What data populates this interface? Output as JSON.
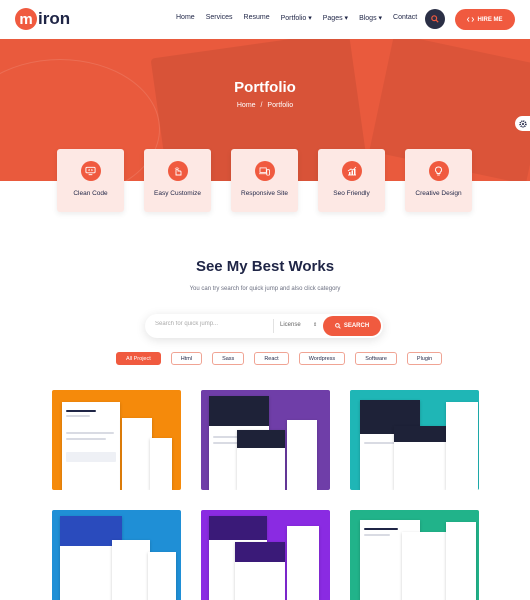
{
  "brand": {
    "logo_letter": "m",
    "logo_rest": "iron",
    "accent": "#f05a3f",
    "dark": "#1f2546"
  },
  "nav": {
    "items": [
      "Home",
      "Services",
      "Resume",
      "Portfolio ▾",
      "Pages ▾",
      "Blogs ▾",
      "Contact"
    ],
    "search_icon": "search-icon",
    "hire_label": "HIRE ME"
  },
  "hero": {
    "title": "Portfolio",
    "breadcrumb_home": "Home",
    "breadcrumb_sep": "/",
    "breadcrumb_current": "Portfolio"
  },
  "features": [
    {
      "label": "Clean Code",
      "icon": "monitor-code-icon"
    },
    {
      "label": "Easy Customize",
      "icon": "cursor-hand-icon"
    },
    {
      "label": "Responsive Site",
      "icon": "responsive-devices-icon"
    },
    {
      "label": "Seo Friendly",
      "icon": "chart-growth-icon"
    },
    {
      "label": "Creative Design",
      "icon": "lightbulb-icon"
    }
  ],
  "works": {
    "title": "See My Best Works",
    "subtitle": "You can try search for quick jump and also click category",
    "search_placeholder": "Search for quick jump...",
    "license_label": "License",
    "search_button": "SEARCH"
  },
  "filters": [
    "All Project",
    "Html",
    "Sass",
    "React",
    "Wordpress",
    "Software",
    "Plugin"
  ],
  "active_filter": "All Project",
  "portfolio": [
    {
      "bg": "#f58a0b"
    },
    {
      "bg": "#6f3ea8"
    },
    {
      "bg": "#1fb6b6"
    },
    {
      "bg": "#1f8fd6"
    },
    {
      "bg": "#8a2be2"
    },
    {
      "bg": "#21b38a"
    }
  ]
}
